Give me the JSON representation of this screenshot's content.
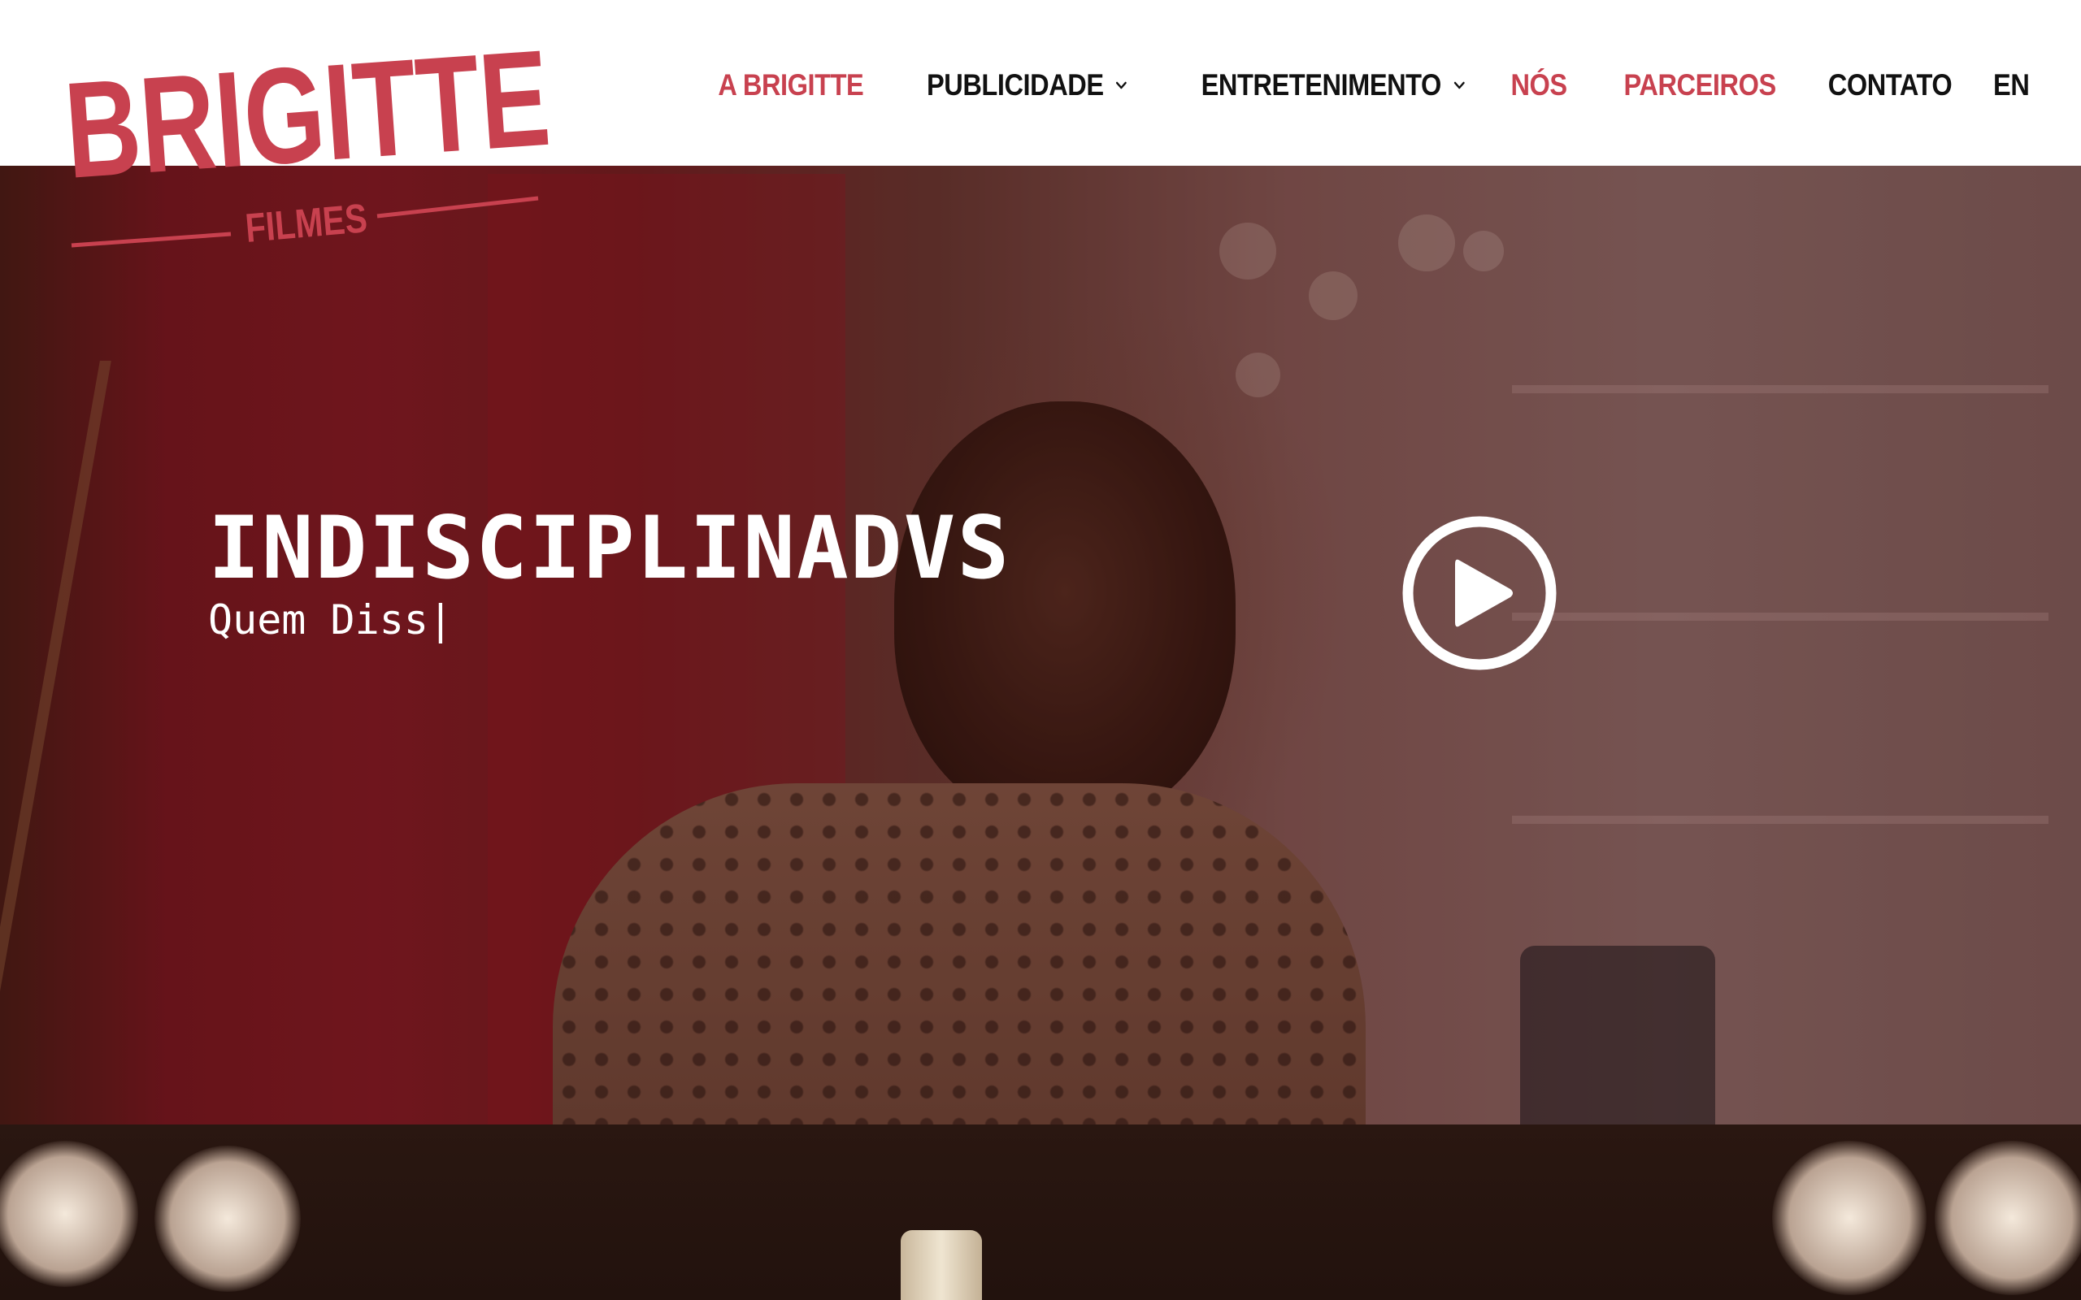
{
  "logo": {
    "name": "BRIGITTE",
    "sub": "FILMES",
    "color": "#c8414f"
  },
  "nav": {
    "items": [
      {
        "label": "A BRIGITTE",
        "color": "red"
      },
      {
        "label": "PUBLICIDADE",
        "color": "dark",
        "dropdown": true
      },
      {
        "label": "ENTRETENIMENTO",
        "color": "dark",
        "dropdown": true
      },
      {
        "label": "NÓS",
        "color": "red"
      },
      {
        "label": "PARCEIROS",
        "color": "red"
      },
      {
        "label": "CONTATO",
        "color": "dark"
      },
      {
        "label": "EN",
        "color": "dark"
      }
    ]
  },
  "hero": {
    "title": "INDISCIPLINADVS",
    "subtitle": "Quem Diss|",
    "play_icon": "play-circle-icon"
  },
  "colors": {
    "accent": "#c8414f",
    "nav_dark": "#111111",
    "header_bg": "#ffffff"
  }
}
